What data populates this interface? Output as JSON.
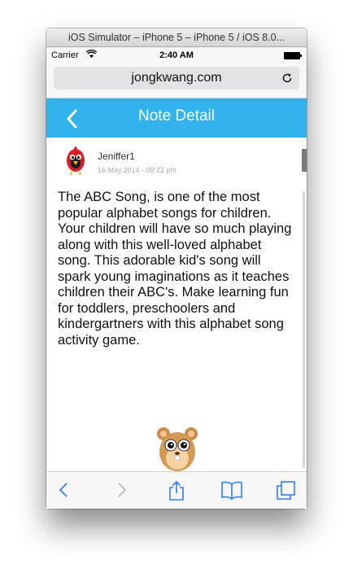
{
  "simulator": {
    "title": "iOS Simulator – iPhone 5 – iPhone 5 / iOS 8.0..."
  },
  "status_bar": {
    "carrier": "Carrier",
    "time": "2:40 AM"
  },
  "browser": {
    "url": "jongkwang.com"
  },
  "nav": {
    "title": "Note Detail"
  },
  "note": {
    "author": "Jeniffer1",
    "date": "16.May.2014 - 09:23 pm",
    "body": "The ABC Song, is one of the most popular alphabet songs for children. Your children will have so much playing along with this well-loved alphabet song. This adorable kid's song will spark young imaginations as it teaches children their ABC's. Make learning fun for toddlers, preschoolers and kindergartners with this alphabet song activity game."
  },
  "colors": {
    "accent": "#32b3ee",
    "toolbar_icon": "#2f7df6"
  },
  "icons": {
    "toolbar": [
      "back-icon",
      "forward-icon",
      "share-icon",
      "bookmarks-icon",
      "tabs-icon"
    ]
  }
}
